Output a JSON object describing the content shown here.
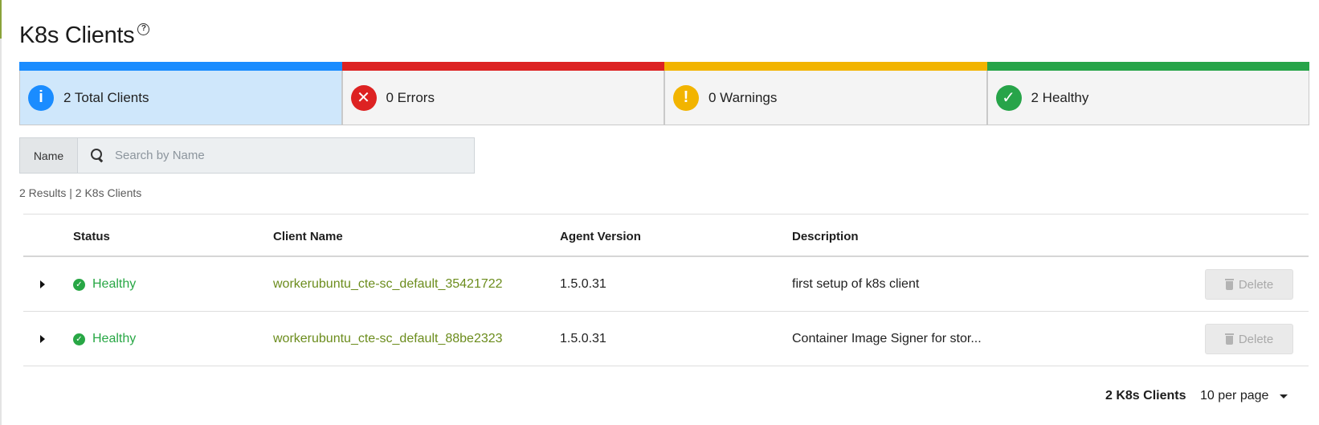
{
  "page": {
    "title": "K8s Clients"
  },
  "summary_cards": [
    {
      "label": "2 Total Clients",
      "icon": "info-icon",
      "color": "#1a8cff",
      "glyph": "i"
    },
    {
      "label": "0 Errors",
      "icon": "error-icon",
      "color": "#dd2222",
      "glyph": "✕"
    },
    {
      "label": "0 Warnings",
      "icon": "warning-icon",
      "color": "#f2b400",
      "glyph": "!"
    },
    {
      "label": "2 Healthy",
      "icon": "check-icon",
      "color": "#27a449",
      "glyph": "✓"
    }
  ],
  "filter": {
    "label": "Name",
    "placeholder": "Search by Name",
    "value": ""
  },
  "results_text": "2 Results | 2 K8s Clients",
  "table": {
    "columns": [
      "Status",
      "Client Name",
      "Agent Version",
      "Description"
    ],
    "rows": [
      {
        "status": "Healthy",
        "client_name": "workerubuntu_cte-sc_default_35421722",
        "agent_version": "1.5.0.31",
        "description": "first setup of k8s client",
        "action": "Delete"
      },
      {
        "status": "Healthy",
        "client_name": "workerubuntu_cte-sc_default_88be2323",
        "agent_version": "1.5.0.31",
        "description": "Container Image Signer for stor...",
        "action": "Delete"
      }
    ]
  },
  "pagination": {
    "count_label": "2 K8s Clients",
    "per_page": "10 per page"
  },
  "colors": {
    "accent_link": "#6b8c1c",
    "healthy": "#28a745"
  }
}
